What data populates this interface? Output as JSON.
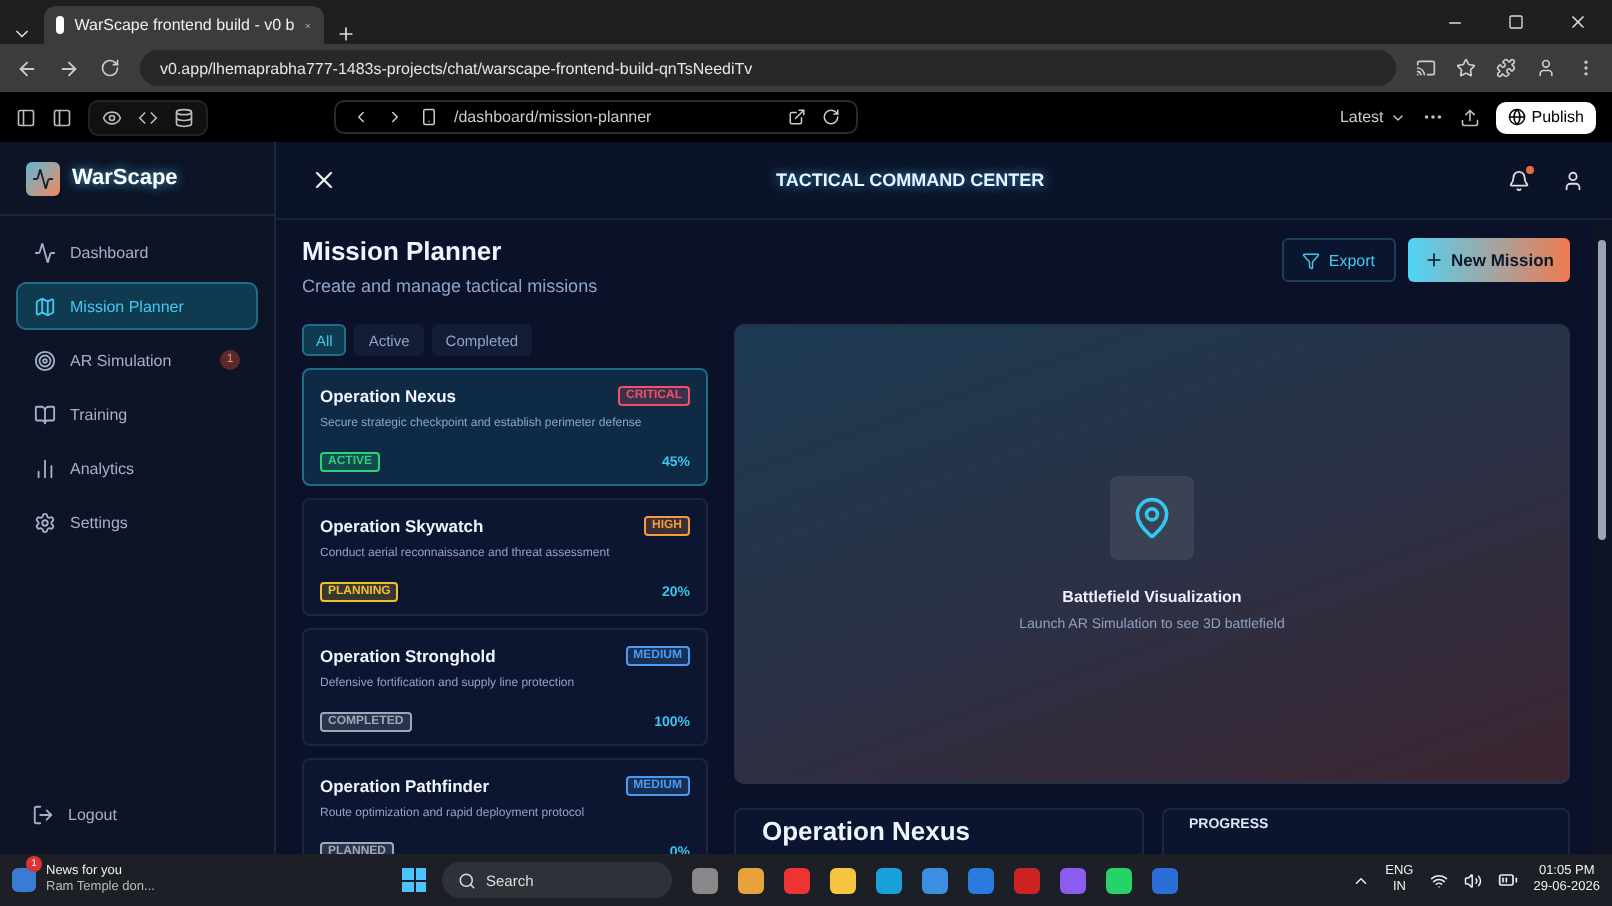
{
  "browser": {
    "tab_title": "WarScape frontend build - v0 b",
    "url": "v0.app/lhemaprabha777-1483s-projects/chat/warscape-frontend-build-qnTsNeediTv"
  },
  "v0_toolbar": {
    "path": "/dashboard/mission-planner",
    "version": "Latest",
    "publish": "Publish"
  },
  "sidebar": {
    "brand": "WarScape",
    "items": [
      {
        "label": "Dashboard",
        "selected": false
      },
      {
        "label": "Mission Planner",
        "selected": true
      },
      {
        "label": "AR Simulation",
        "selected": false,
        "badge": "1"
      },
      {
        "label": "Training",
        "selected": false
      },
      {
        "label": "Analytics",
        "selected": false
      },
      {
        "label": "Settings",
        "selected": false
      }
    ],
    "logout": "Logout"
  },
  "header": {
    "title": "TACTICAL COMMAND CENTER",
    "unread_notifications": true
  },
  "page": {
    "title": "Mission Planner",
    "subtitle": "Create and manage tactical missions",
    "export": "Export",
    "new_mission": "New Mission"
  },
  "filters": [
    {
      "label": "All",
      "selected": true
    },
    {
      "label": "Active",
      "selected": false
    },
    {
      "label": "Completed",
      "selected": false
    }
  ],
  "missions": [
    {
      "name": "Operation Nexus",
      "priority": {
        "text": "CRITICAL",
        "color": "#f0506a"
      },
      "description": "Secure strategic checkpoint and establish perimeter defense",
      "status": {
        "text": "ACTIVE",
        "color": "#2ed07a"
      },
      "progress": "45%",
      "selected": true
    },
    {
      "name": "Operation Skywatch",
      "priority": {
        "text": "HIGH",
        "color": "#f59a40"
      },
      "description": "Conduct aerial reconnaissance and threat assessment",
      "status": {
        "text": "PLANNING",
        "color": "#f0c030"
      },
      "progress": "20%",
      "selected": false
    },
    {
      "name": "Operation Stronghold",
      "priority": {
        "text": "MEDIUM",
        "color": "#4a9af0"
      },
      "description": "Defensive fortification and supply line protection",
      "status": {
        "text": "COMPLETED",
        "color": "#a0a8b8"
      },
      "progress": "100%",
      "selected": false
    },
    {
      "name": "Operation Pathfinder",
      "priority": {
        "text": "MEDIUM",
        "color": "#4a9af0"
      },
      "description": "Route optimization and rapid deployment protocol",
      "status": {
        "text": "PLANNED",
        "color": "#a0a8b8"
      },
      "progress": "0%",
      "selected": false
    }
  ],
  "visualization": {
    "title": "Battlefield Visualization",
    "subtitle": "Launch AR Simulation to see 3D battlefield"
  },
  "detail": {
    "mission_title": "Operation Nexus",
    "progress_label": "PROGRESS"
  },
  "taskbar": {
    "news_badge": "1",
    "news_title": "News for you",
    "news_text": "Ram Temple don...",
    "search": "Search",
    "language": "ENG",
    "region": "IN",
    "time": "01:05 PM",
    "date": "29-06-2026"
  }
}
